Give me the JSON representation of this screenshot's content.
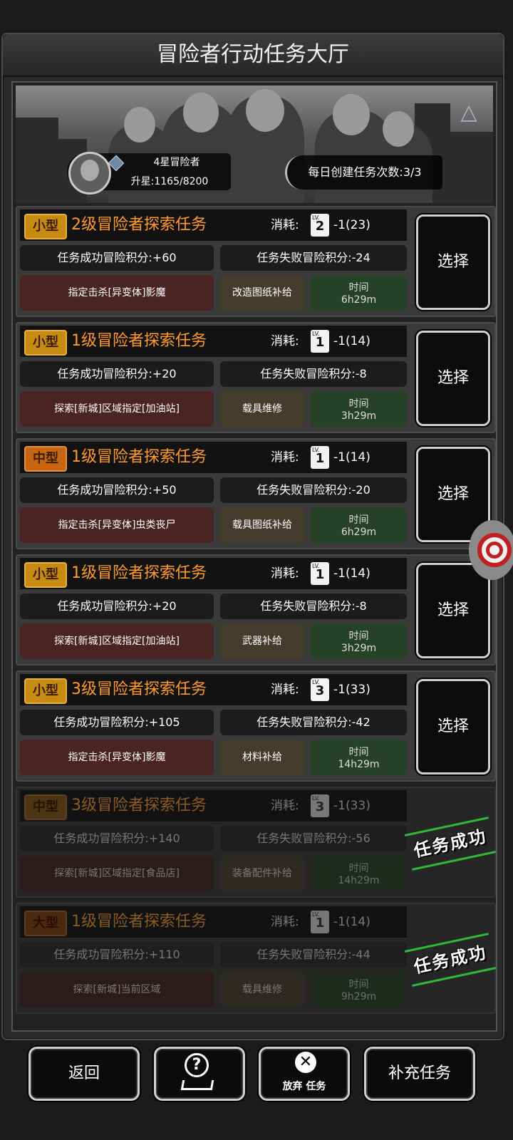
{
  "title": "冒险者行动任务大厅",
  "rank": {
    "title": "4星冒险者",
    "xp": "升星:1165/8200"
  },
  "daily": "每日创建任务次数:3/3",
  "choose_label": "选择",
  "cost_label": "消耗:",
  "stamp_label": "任务成功",
  "tasks": [
    {
      "size": "小型",
      "name": "2级冒险者探索任务",
      "lv": "2",
      "cost": "-1(23)",
      "success": "任务成功冒险积分:+60",
      "fail": "任务失败冒险积分:-24",
      "target": "指定击杀[异变体]影魔",
      "reward": "改造图纸补给",
      "time_label": "时间",
      "time": "6h29m"
    },
    {
      "size": "小型",
      "name": "1级冒险者探索任务",
      "lv": "1",
      "cost": "-1(14)",
      "success": "任务成功冒险积分:+20",
      "fail": "任务失败冒险积分:-8",
      "target": "探索[新城]区域指定[加油站]",
      "reward": "载具维修",
      "time_label": "时间",
      "time": "3h29m"
    },
    {
      "size": "中型",
      "name": "1级冒险者探索任务",
      "lv": "1",
      "cost": "-1(14)",
      "success": "任务成功冒险积分:+50",
      "fail": "任务失败冒险积分:-20",
      "target": "指定击杀[异变体]虫类丧尸",
      "reward": "载具图纸补给",
      "time_label": "时间",
      "time": "6h29m"
    },
    {
      "size": "小型",
      "name": "1级冒险者探索任务",
      "lv": "1",
      "cost": "-1(14)",
      "success": "任务成功冒险积分:+20",
      "fail": "任务失败冒险积分:-8",
      "target": "探索[新城]区域指定[加油站]",
      "reward": "武器补给",
      "time_label": "时间",
      "time": "3h29m"
    },
    {
      "size": "小型",
      "name": "3级冒险者探索任务",
      "lv": "3",
      "cost": "-1(33)",
      "success": "任务成功冒险积分:+105",
      "fail": "任务失败冒险积分:-42",
      "target": "指定击杀[异变体]影魔",
      "reward": "材料补给",
      "time_label": "时间",
      "time": "14h29m"
    },
    {
      "size": "中型",
      "name": "3级冒险者探索任务",
      "lv": "3",
      "cost": "-1(33)",
      "success": "任务成功冒险积分:+140",
      "fail": "任务失败冒险积分:-56",
      "target": "探索[新城]区域指定[食品店]",
      "reward": "装备配件补给",
      "time_label": "时间",
      "time": "14h29m"
    },
    {
      "size": "大型",
      "name": "1级冒险者探索任务",
      "lv": "1",
      "cost": "-1(14)",
      "success": "任务成功冒险积分:+110",
      "fail": "任务失败冒险积分:-44",
      "target": "探索[新城]当前区域",
      "reward": "载具维修",
      "time_label": "时间",
      "time": "9h29m"
    }
  ],
  "buttons": {
    "back": "返回",
    "abandon": "放弃 任务",
    "replenish": "补充任务"
  },
  "colors": {
    "accent_orange": "#ff9a2a",
    "stamp_green": "#2fb93a"
  }
}
